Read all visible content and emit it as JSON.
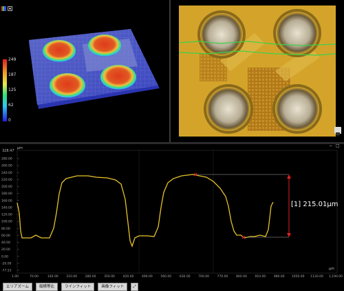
{
  "viewer3d": {
    "legend_ticks": [
      "249",
      "187",
      "125",
      "62",
      "0"
    ],
    "colors": {
      "high": "#e0301e",
      "mid": "#e8e84a",
      "low": "#3a3af0",
      "green": "#39e07a",
      "cyan": "#38d8f0"
    }
  },
  "optical": {
    "colors": {
      "gold": "#d9a62a",
      "bump": "#c9c0a8",
      "trace": "#3bd14a"
    }
  },
  "profile": {
    "y_unit": "μm",
    "x_unit": "μm",
    "y_max_label": "328.47",
    "y_ticks": [
      "280.00",
      "260.00",
      "240.00",
      "220.00",
      "200.00",
      "180.00",
      "160.00",
      "140.00",
      "120.00",
      "100.00",
      "80.00",
      "60.00",
      "40.00",
      "20.00",
      "0.00",
      "-20.00",
      "-77.53"
    ],
    "x_ticks": [
      "1.00",
      "70.00",
      "140.00",
      "210.00",
      "280.00",
      "350.00",
      "420.00",
      "490.00",
      "560.00",
      "630.00",
      "700.00",
      "770.00",
      "840.00",
      "910.00",
      "980.00",
      "1050.00",
      "1120.00",
      "1,190.00"
    ],
    "measurement_label": "[1] 215.01μm",
    "colors": {
      "profile": "#e8c22a",
      "marker": "#e02020"
    }
  },
  "toolbar": {
    "buttons": [
      "エリアズーム",
      "縦横等比",
      "ラインフィット",
      "画像フィット"
    ]
  },
  "window_controls": {
    "minimize": "−",
    "restore": "□"
  }
}
